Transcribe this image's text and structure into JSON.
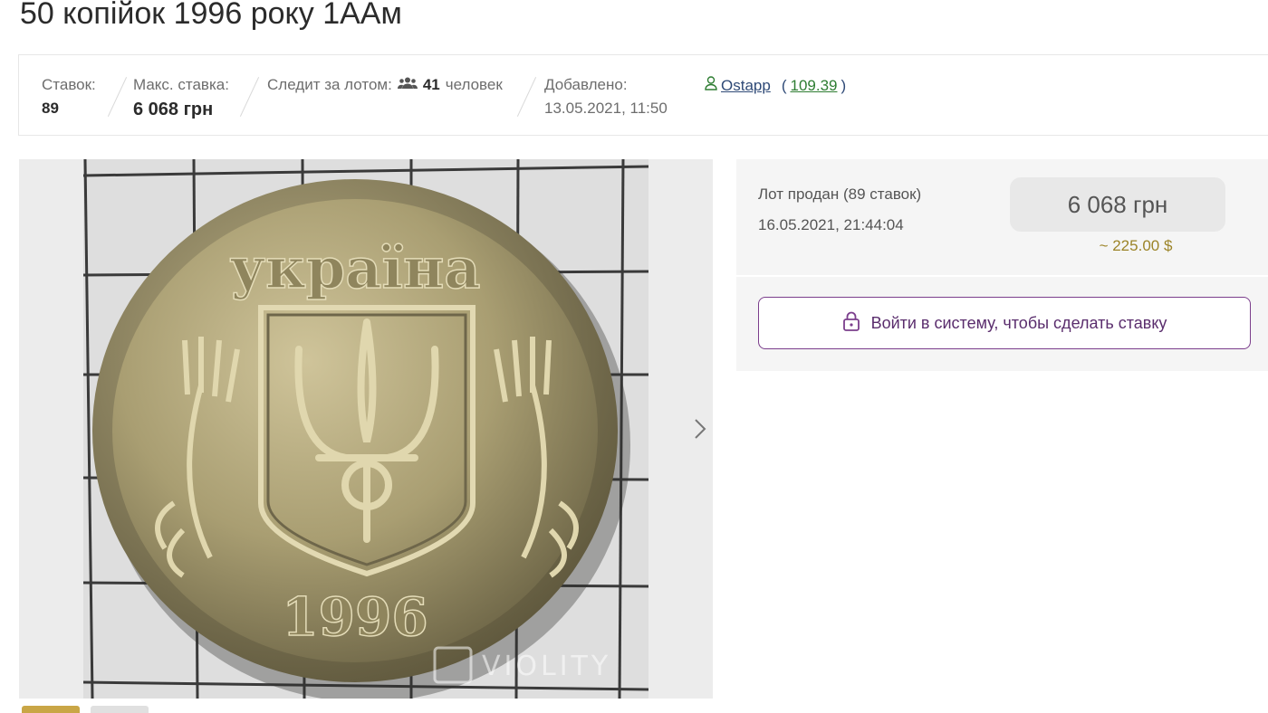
{
  "page": {
    "title": "50 копійок 1996 року 1ААм"
  },
  "stats": {
    "bids_label": "Ставок:",
    "bids_value": "89",
    "max_bid_label": "Макс. ставка:",
    "max_bid_value": "6 068 грн",
    "watching_label": "Следит за лотом:",
    "watching_count": "41",
    "watching_unit": "человек",
    "added_label": "Добавлено:",
    "added_value": "13.05.2021, 11:50"
  },
  "seller": {
    "name": "Ostapp",
    "rating": "109.39",
    "paren_open": "(",
    "paren_close": ")"
  },
  "gallery": {
    "watermark": "VIOLITY",
    "coin_text": "україна",
    "coin_year": "1996"
  },
  "sale": {
    "status": "Лот продан (89 ставок)",
    "ended": "16.05.2021, 21:44:04",
    "price": "6 068 грн",
    "price_usd": "~ 225.00 $",
    "login_button": "Войти в систему, чтобы сделать ставку"
  },
  "icons": {
    "people": "people-icon",
    "user": "user-icon",
    "lock": "lock-icon",
    "next": "chevron-right-icon"
  },
  "colors": {
    "accent_purple": "#7b3e8c",
    "rating_green": "#2e7d32",
    "usd_gold": "#9c8428",
    "link_blue": "#2f4a77"
  }
}
